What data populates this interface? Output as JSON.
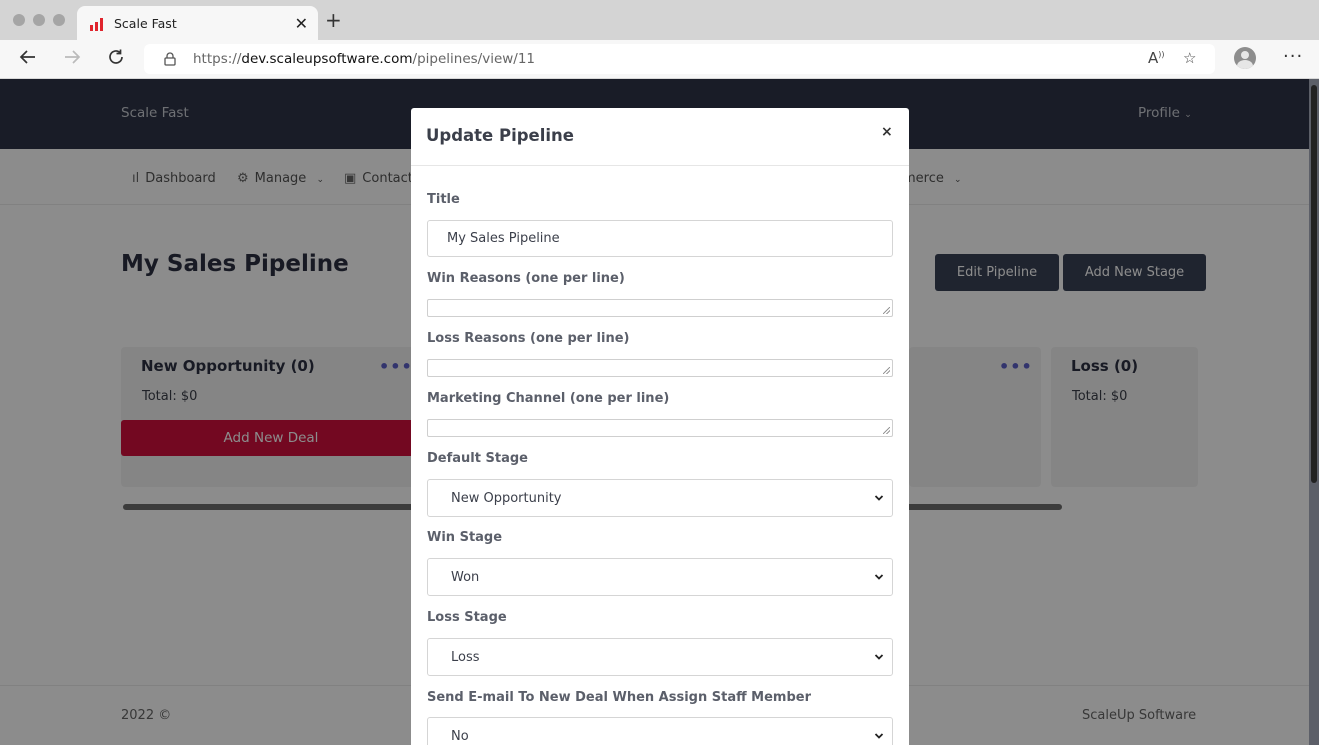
{
  "browser": {
    "tab_title": "Scale Fast",
    "url_scheme": "https://",
    "url_host": "dev.scaleupsoftware.com",
    "url_path": "/pipelines/view/11"
  },
  "app": {
    "brand": "Scale Fast",
    "profile_label": "Profile",
    "menu": {
      "dashboard": "Dashboard",
      "manage": "Manage",
      "contacts": "Contact",
      "ecommerce": "merce"
    }
  },
  "pipeline": {
    "title": "My Sales Pipeline",
    "edit_button": "Edit Pipeline",
    "add_stage_button": "Add New Stage",
    "stages": [
      {
        "name": "New Opportunity (0)",
        "total": "Total: $0",
        "add_deal": "Add New Deal"
      },
      {
        "name": "Loss (0)",
        "total": "Total: $0"
      }
    ]
  },
  "footer": {
    "copyright": "2022 ©",
    "company": "ScaleUp Software"
  },
  "modal": {
    "title": "Update Pipeline",
    "close": "×",
    "fields": {
      "title_label": "Title",
      "title_value": "My Sales Pipeline",
      "win_reasons_label": "Win Reasons (one per line)",
      "loss_reasons_label": "Loss Reasons (one per line)",
      "marketing_channel_label": "Marketing Channel (one per line)",
      "default_stage_label": "Default Stage",
      "default_stage_value": "New Opportunity",
      "win_stage_label": "Win Stage",
      "win_stage_value": "Won",
      "loss_stage_label": "Loss Stage",
      "loss_stage_value": "Loss",
      "send_email_label": "Send E-mail To New Deal When Assign Staff Member",
      "send_email_value": "No"
    }
  }
}
